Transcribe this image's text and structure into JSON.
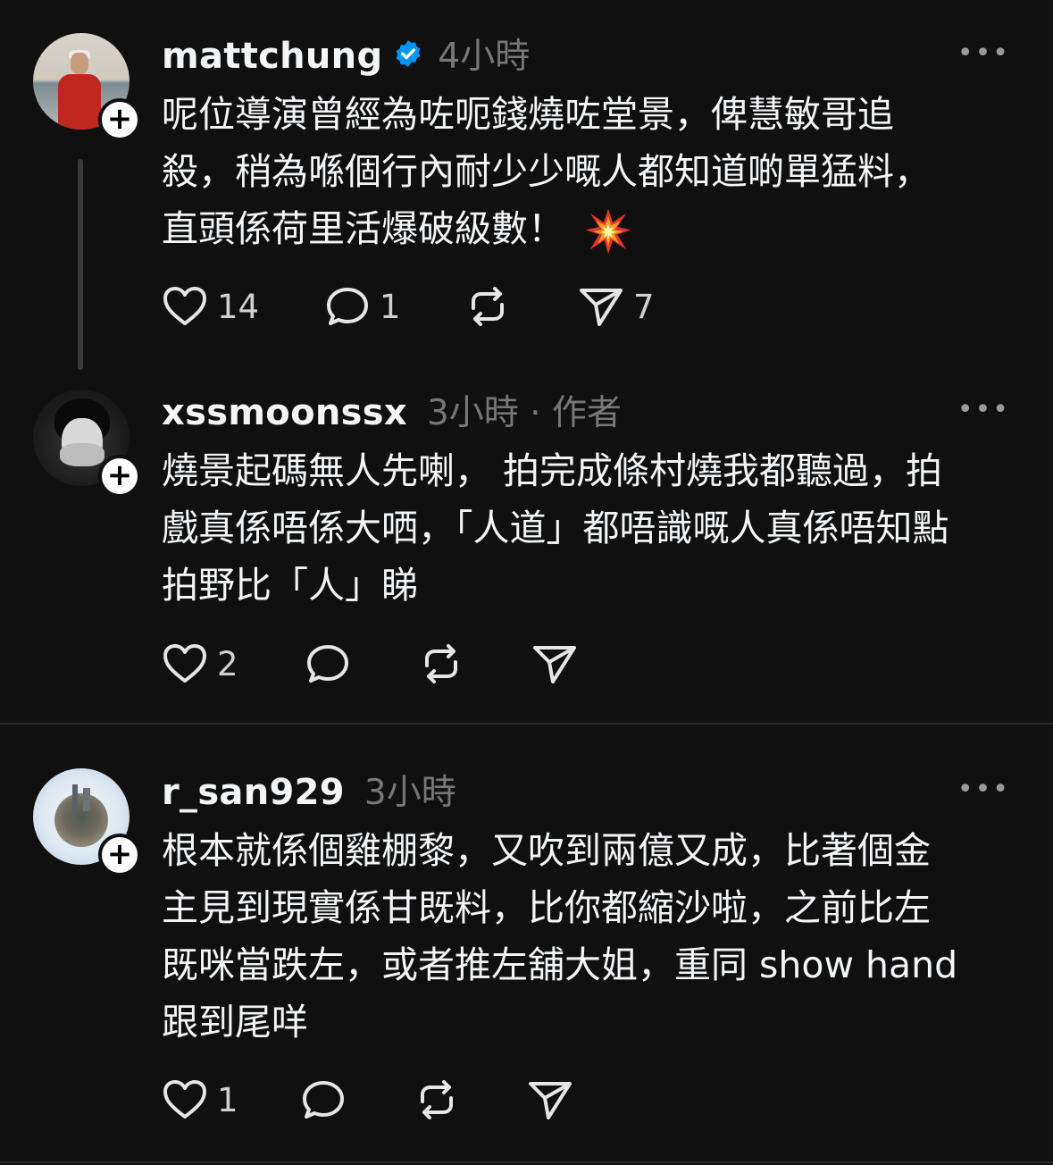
{
  "posts": [
    {
      "username": "mattchung",
      "verified": true,
      "time": "4小時",
      "text": "呢位導演曾經為咗呃錢燒咗堂景，俾慧敏哥追\n殺，稍為喺個行內耐少少嘅人都知道啲單猛料，\n直頭係荷里活爆破級數！",
      "emoji": "collision-emoji",
      "likes": "14",
      "replies": "1",
      "reposts": "",
      "shares": "7"
    },
    {
      "username": "xssmoonssx",
      "verified": false,
      "time": "3小時 · 作者",
      "text": "燒景起碼無人先喇，  拍完成條村燒我都聽過，拍\n戲真係唔係大哂，「人道」都唔識嘅人真係唔知點\n拍野比「人」睇",
      "likes": "2",
      "replies": "",
      "reposts": "",
      "shares": ""
    },
    {
      "username": "r_san929",
      "verified": false,
      "time": "3小時",
      "text": "根本就係個雞棚黎，又吹到兩億又成，比著個金\n主見到現實係甘既料，比你都縮沙啦，之前比左\n既咪當跌左，或者推左舖大姐，重同 show hand\n跟到尾咩",
      "likes": "1",
      "replies": "",
      "reposts": "",
      "shares": ""
    }
  ],
  "icons": {
    "more": "more-horizontal-icon",
    "verified": "verified-badge-icon",
    "follow": "plus-icon",
    "like": "heart-icon",
    "reply": "comment-icon",
    "repost": "repost-icon",
    "share": "send-icon"
  },
  "ui": {
    "more_glyph": "•••",
    "plus_glyph": "+"
  },
  "colors": {
    "background": "#101010",
    "text": "#f3f5f7",
    "muted": "#777777",
    "verified_blue": "#0095f6"
  }
}
